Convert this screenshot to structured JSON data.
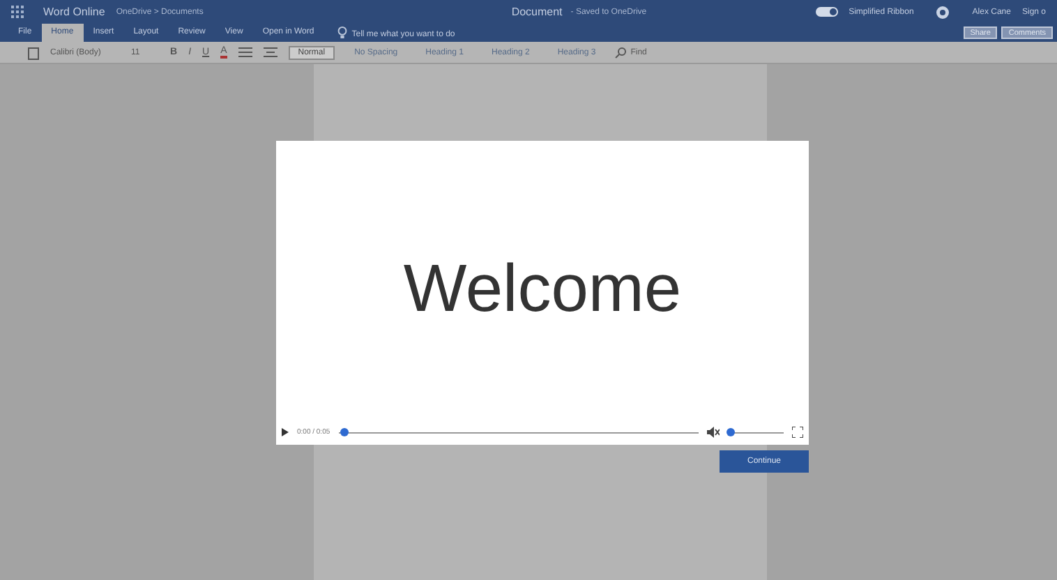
{
  "header": {
    "app_name": "Word Online",
    "breadcrumb": "OneDrive > Documents",
    "doc_title": "Document",
    "save_status": "- Saved to OneDrive",
    "simplified_ribbon": {
      "label": "Simplified Ribbon",
      "on": true
    },
    "user": "Alex Cane",
    "sign_out": "Sign o"
  },
  "tabs": [
    {
      "label": "File",
      "selected": false
    },
    {
      "label": "Home",
      "selected": true
    },
    {
      "label": "Insert",
      "selected": false
    },
    {
      "label": "Layout",
      "selected": false
    },
    {
      "label": "Review",
      "selected": false
    },
    {
      "label": "View",
      "selected": false
    },
    {
      "label": "Open in Word",
      "selected": false
    }
  ],
  "tell_me": "Tell me what you want to do",
  "share": "Share",
  "comments": "Comments",
  "ribbon": {
    "font": "Calibri (Body)",
    "size": "11",
    "bold": "B",
    "italic": "I",
    "underline": "U",
    "font_color": "A",
    "styles": [
      {
        "label": "Normal",
        "selected": true
      },
      {
        "label": "No Spacing",
        "selected": false
      },
      {
        "label": "Heading 1",
        "selected": false
      },
      {
        "label": "Heading 2",
        "selected": false
      },
      {
        "label": "Heading 3",
        "selected": false
      }
    ],
    "find": "Find"
  },
  "video": {
    "title": "Welcome",
    "time": "0:00 / 0:05",
    "progress": {
      "level": 0.01
    },
    "volume": {
      "level": 0.0
    }
  },
  "continue": "Continue"
}
